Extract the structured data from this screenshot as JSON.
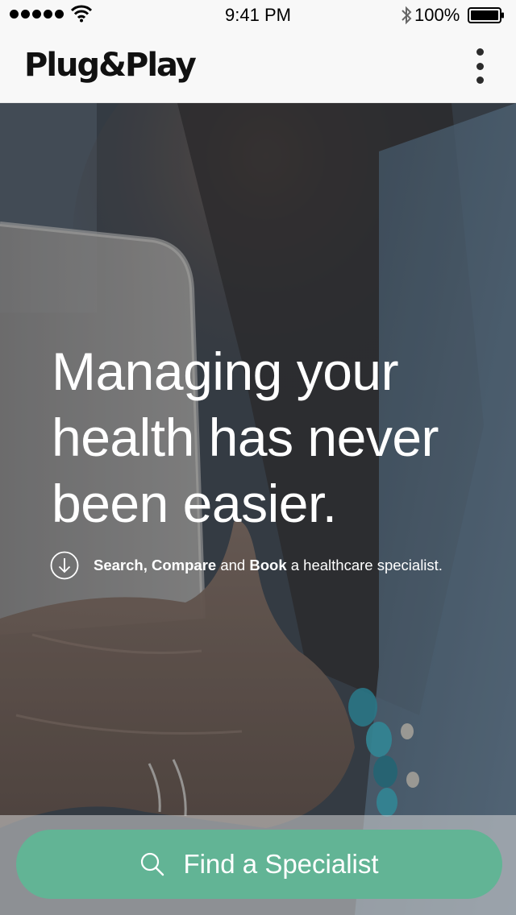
{
  "status_bar": {
    "time": "9:41 PM",
    "battery_percent": "100%",
    "signal_bars": 5,
    "icons": [
      "signal-dots-icon",
      "wifi-icon",
      "bluetooth-icon",
      "battery-icon"
    ]
  },
  "navbar": {
    "brand": "Plug&Play",
    "menu_icon": "kebab-menu-icon"
  },
  "hero": {
    "headline": "Managing your health has never been easier.",
    "tagline": {
      "word1": "Search,",
      "word2": "Compare",
      "and": "and",
      "word3": "Book",
      "rest": "a healthcare specialist."
    },
    "icon": "arrow-down-circle-icon"
  },
  "cta": {
    "label": "Find a Specialist",
    "icon": "search-icon"
  },
  "colors": {
    "cta_green": "#62b495",
    "bar_background": "#f8f8f8",
    "text_white": "#ffffff"
  }
}
